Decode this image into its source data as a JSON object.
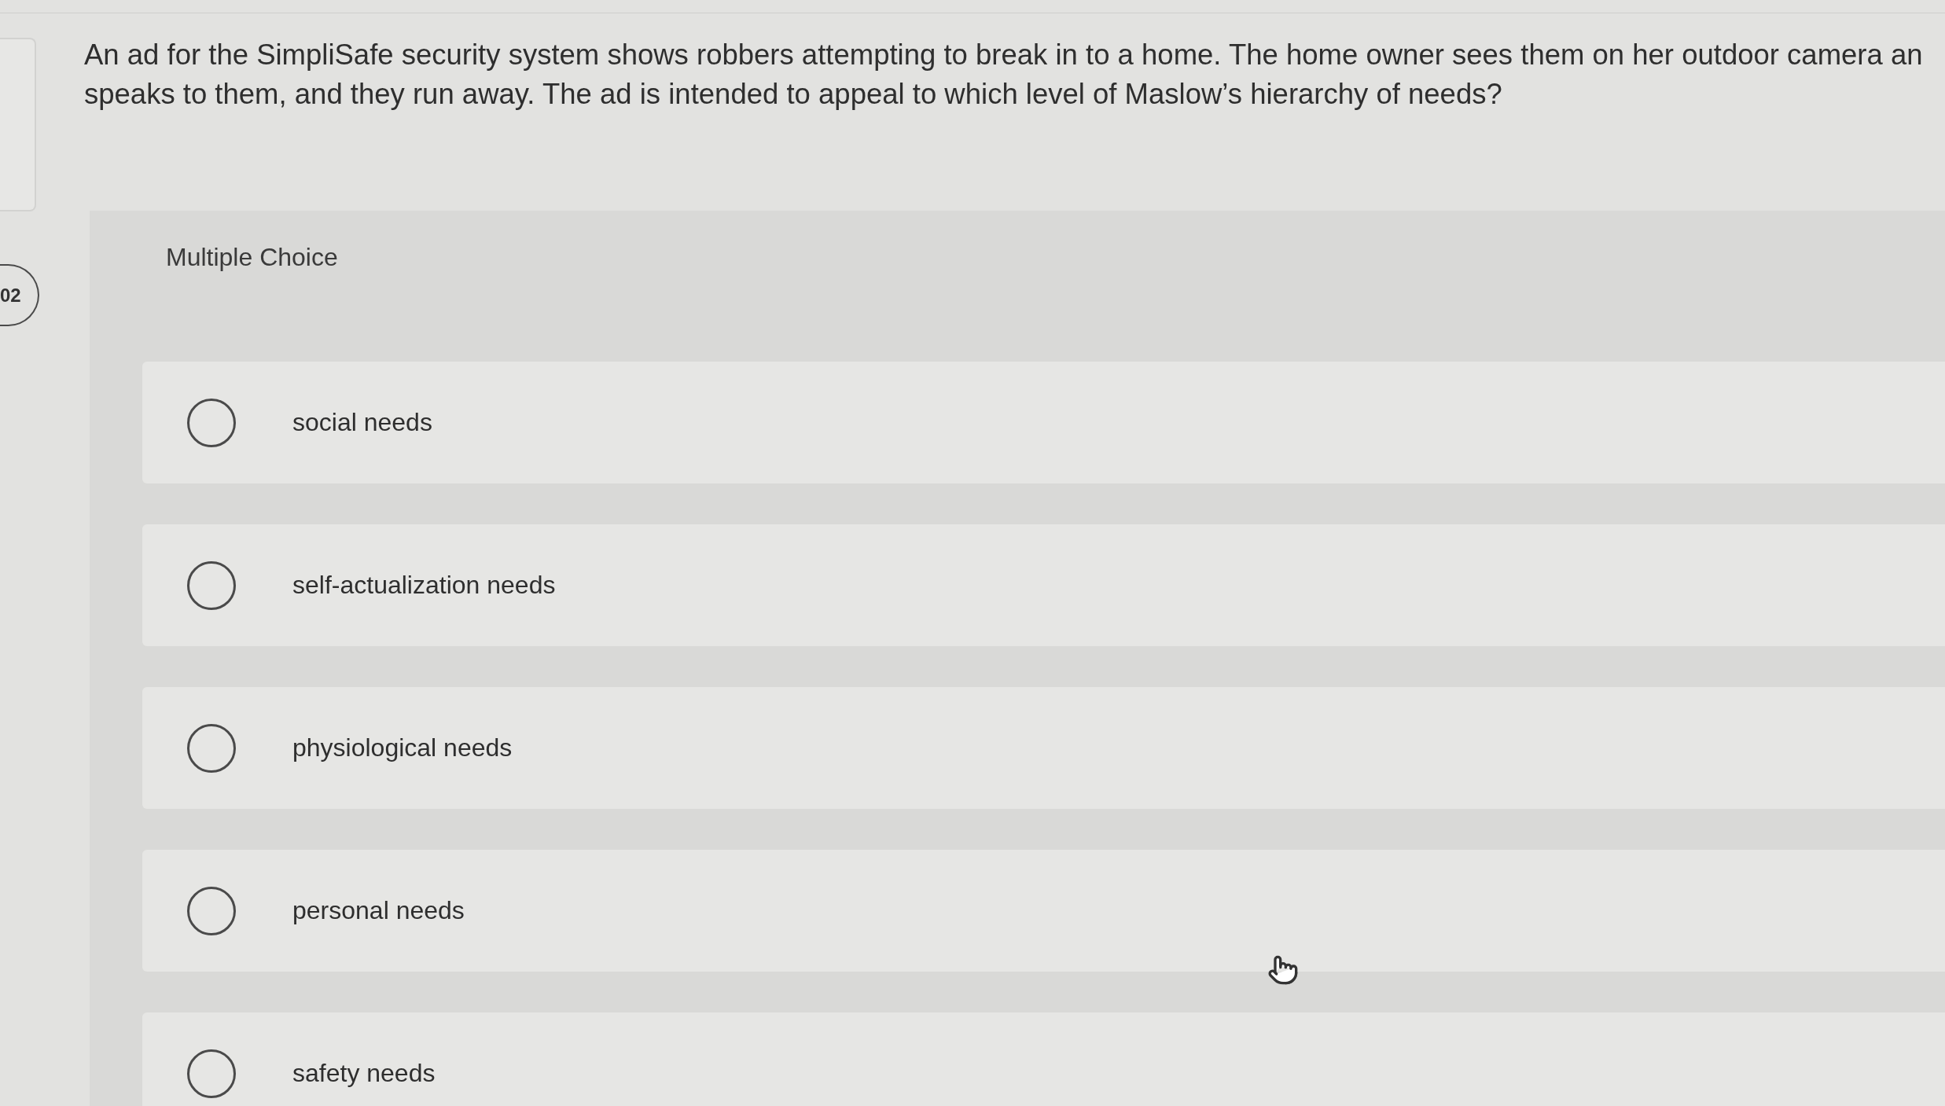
{
  "sidebar": {
    "question_number": "02"
  },
  "question": {
    "lines": [
      "An ad for the SimpliSafe security system shows robbers attempting to break in to a home. The home owner sees them on her outdoor camera an",
      "speaks to them, and they run away. The ad is intended to appeal to which level of Maslow’s hierarchy of needs?"
    ]
  },
  "answer_panel": {
    "type_label": "Multiple Choice",
    "options": [
      {
        "label": "social needs",
        "selected": false
      },
      {
        "label": "self-actualization needs",
        "selected": false
      },
      {
        "label": "physiological needs",
        "selected": false
      },
      {
        "label": "personal needs",
        "selected": false
      },
      {
        "label": "safety needs",
        "selected": false
      }
    ]
  }
}
